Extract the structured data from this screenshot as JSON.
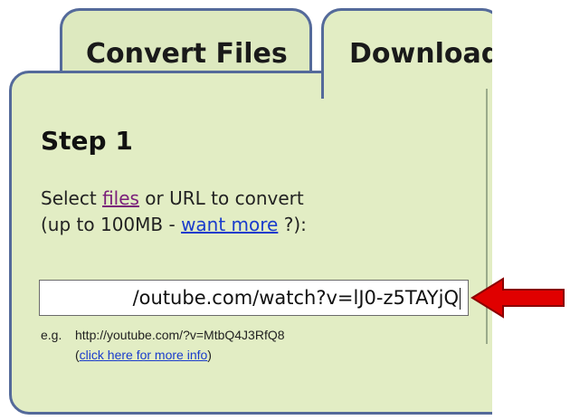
{
  "tabs": [
    {
      "label": "Convert Files"
    },
    {
      "label": "Download"
    }
  ],
  "step": {
    "title": "Step 1",
    "line1_prefix": "Select ",
    "files_link": "files",
    "line1_suffix": " or URL to convert",
    "line2_prefix": "(up to 100MB - ",
    "more_link": "want more",
    "line2_suffix": " ?):"
  },
  "url_input": {
    "value": "/outube.com/watch?v=lJ0-z5TAYjQ"
  },
  "example": {
    "prefix": "e.g.",
    "url": "http://youtube.com/?v=MtbQ4J3RfQ8",
    "open_paren": "(",
    "info_link": "click here for more info",
    "close_paren": ")"
  },
  "colors": {
    "panel_bg": "#e2edc4",
    "border": "#546a9a",
    "arrow": "#e00000"
  },
  "icons": {
    "pointer": "red-arrow-icon"
  }
}
